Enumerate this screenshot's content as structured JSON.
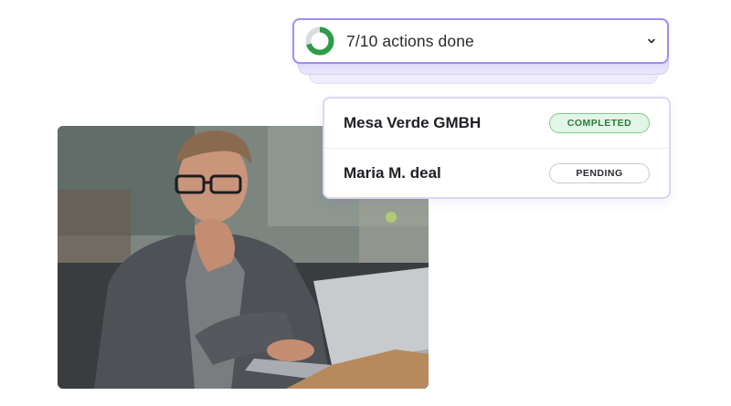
{
  "progress": {
    "label": "7/10 actions done",
    "done": 7,
    "total": 10,
    "fraction": 0.7,
    "ring_color": "#2e9b48",
    "ring_track_color": "#d9dde0",
    "icon": "chevron-down-icon"
  },
  "tasks": [
    {
      "name": "Mesa Verde GMBH",
      "status": "COMPLETED"
    },
    {
      "name": "Maria M. deal",
      "status": "PENDING"
    }
  ],
  "colors": {
    "accent_border": "#9b8ff0",
    "completed_bg": "#e3f5e6",
    "completed_text": "#2b7a3c"
  }
}
